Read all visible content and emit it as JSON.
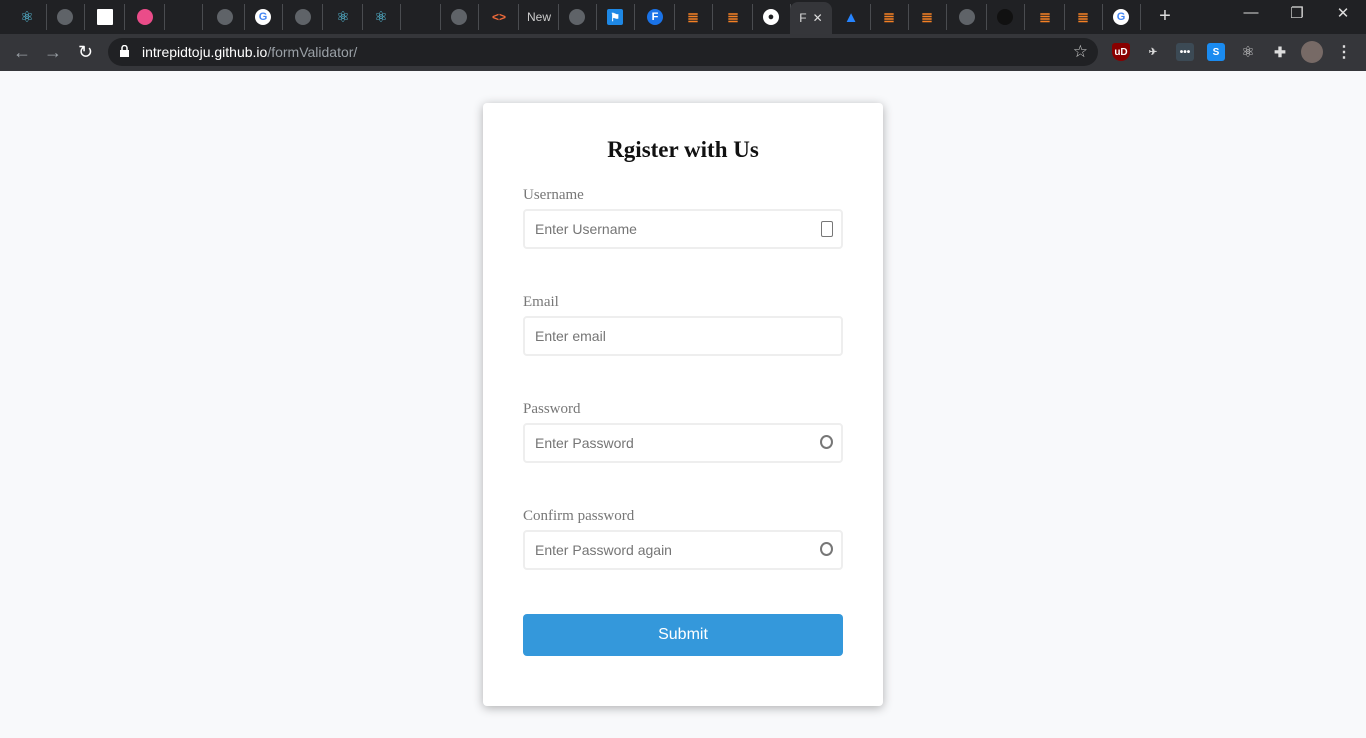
{
  "browser": {
    "tabs": [
      {
        "icon": "react-icon",
        "cls": "f-react",
        "glyph": "⚛"
      },
      {
        "icon": "globe-icon",
        "cls": "f-globe",
        "glyph": ""
      },
      {
        "icon": "blank-page-icon",
        "cls": "f-blank",
        "glyph": ""
      },
      {
        "icon": "dribbble-icon",
        "cls": "f-drib",
        "glyph": ""
      },
      {
        "icon": "dim-tab-icon",
        "cls": "f-dim",
        "glyph": ""
      },
      {
        "icon": "globe-icon",
        "cls": "f-globe",
        "glyph": ""
      },
      {
        "icon": "google-icon",
        "cls": "f-g",
        "glyph": "G"
      },
      {
        "icon": "globe-icon",
        "cls": "f-globe",
        "glyph": ""
      },
      {
        "icon": "react-icon",
        "cls": "f-react",
        "glyph": "⚛"
      },
      {
        "icon": "react-icon",
        "cls": "f-react",
        "glyph": "⚛"
      },
      {
        "icon": "dim-tab-icon",
        "cls": "f-dim",
        "glyph": ""
      },
      {
        "icon": "globe-icon",
        "cls": "f-globe",
        "glyph": ""
      },
      {
        "icon": "code-icon",
        "cls": "f-code",
        "glyph": "<>"
      },
      {
        "icon": "new-tab-text",
        "cls": "f-text",
        "glyph": "New"
      },
      {
        "icon": "globe-icon",
        "cls": "f-globe",
        "glyph": ""
      },
      {
        "icon": "flag-icon",
        "cls": "f-flag",
        "glyph": "⚑"
      },
      {
        "icon": "f-letter-icon",
        "cls": "f-F",
        "glyph": "F"
      },
      {
        "icon": "stackoverflow-icon",
        "cls": "f-so",
        "glyph": "≣"
      },
      {
        "icon": "stackoverflow-icon",
        "cls": "f-so",
        "glyph": "≣"
      },
      {
        "icon": "github-icon",
        "cls": "f-gh",
        "glyph": "●"
      },
      {
        "icon": "active-tab",
        "cls": "active",
        "glyph": "F"
      },
      {
        "icon": "atlassian-icon",
        "cls": "f-atl",
        "glyph": "▲"
      },
      {
        "icon": "stackoverflow-icon",
        "cls": "f-so",
        "glyph": "≣"
      },
      {
        "icon": "stackoverflow-icon",
        "cls": "f-so",
        "glyph": "≣"
      },
      {
        "icon": "globe-icon",
        "cls": "f-globe",
        "glyph": ""
      },
      {
        "icon": "github-icon",
        "cls": "f-gh2",
        "glyph": ""
      },
      {
        "icon": "stackoverflow-icon",
        "cls": "f-so",
        "glyph": "≣"
      },
      {
        "icon": "stackoverflow-icon",
        "cls": "f-so",
        "glyph": "≣"
      },
      {
        "icon": "google-icon",
        "cls": "f-g",
        "glyph": "G"
      }
    ],
    "url_host": "intrepidtoju.github.io",
    "url_path": "/formValidator/"
  },
  "form": {
    "title": "Rgister with Us",
    "fields": [
      {
        "label": "Username",
        "placeholder": "Enter Username",
        "type": "text",
        "icon": "contact-card-icon"
      },
      {
        "label": "Email",
        "placeholder": "Enter email",
        "type": "email",
        "icon": ""
      },
      {
        "label": "Password",
        "placeholder": "Enter Password",
        "type": "password",
        "icon": "key-icon"
      },
      {
        "label": "Confirm password",
        "placeholder": "Enter Password again",
        "type": "password",
        "icon": "key-icon"
      }
    ],
    "submit_label": "Submit",
    "accent_color": "#3498db"
  }
}
